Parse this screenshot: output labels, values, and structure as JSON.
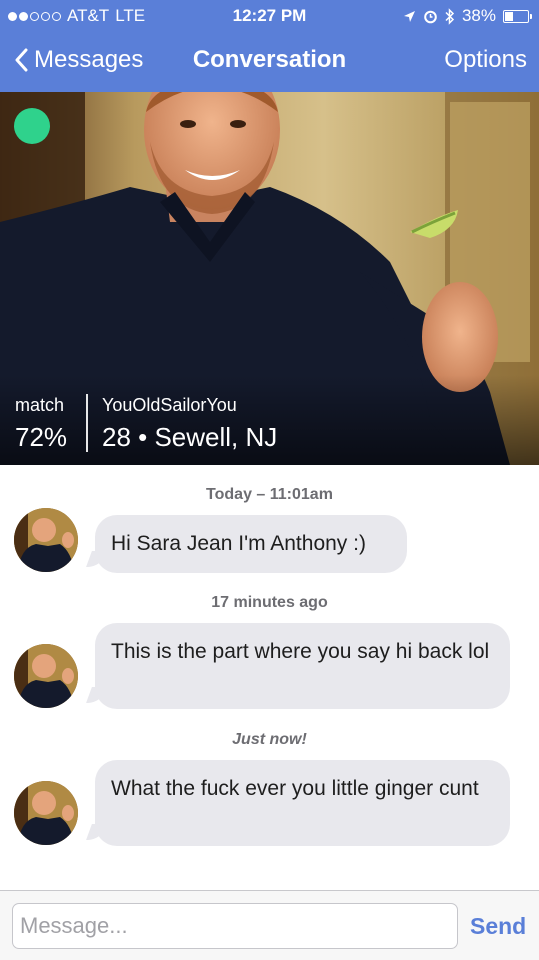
{
  "status_bar": {
    "carrier": "AT&T",
    "network": "LTE",
    "time": "12:27 PM",
    "battery": "38%",
    "battery_level": 0.38,
    "signal_bars_filled": 2,
    "signal_bars_total": 5
  },
  "nav": {
    "back_label": "Messages",
    "title": "Conversation",
    "options_label": "Options"
  },
  "profile": {
    "match_label": "match",
    "match_value": "72%",
    "username": "YouOldSailorYou",
    "age_location": "28 • Sewell, NJ",
    "online_color": "#2fd28c"
  },
  "messages": [
    {
      "timestamp": "Today – 11:01am",
      "timestamp_italic": false,
      "text": "Hi Sara Jean I'm Anthony :)"
    },
    {
      "timestamp": "17 minutes ago",
      "timestamp_italic": false,
      "text": "This is the part where you say hi back lol"
    },
    {
      "timestamp": "Just now!",
      "timestamp_italic": true,
      "text": "What the fuck ever you little ginger cunt"
    }
  ],
  "composer": {
    "placeholder": "Message...",
    "send_label": "Send"
  },
  "colors": {
    "header": "#5a7fd8",
    "bubble": "#e8e8ed",
    "send": "#5a7fd8"
  }
}
